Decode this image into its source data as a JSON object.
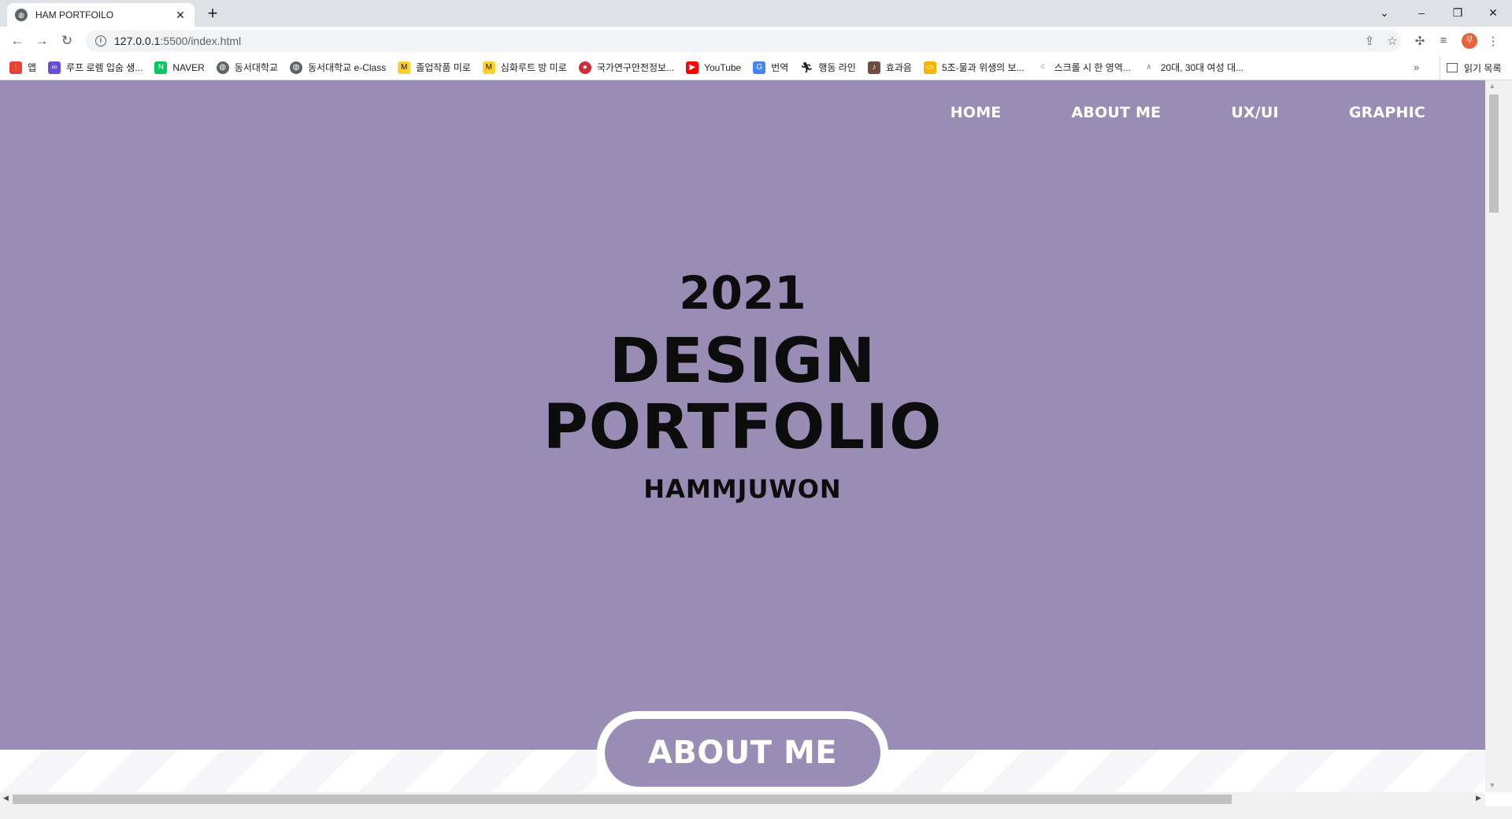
{
  "browser": {
    "tab_title": "HAM PORTFOILO",
    "url_host": "127.0.0.1",
    "url_path": ":5500/index.html",
    "bookmarks": [
      {
        "label": "앱",
        "icon": "apps-grid-icon",
        "color": "#e94235"
      },
      {
        "label": "루프 로렘 입숨 생...",
        "icon": "lorem-icon",
        "color": "#6c4bd6"
      },
      {
        "label": "NAVER",
        "icon": "naver-icon",
        "color": "#03c75a"
      },
      {
        "label": "동서대학교",
        "icon": "globe-icon",
        "color": "#5f6368"
      },
      {
        "label": "동서대학교 e-Class",
        "icon": "globe-icon",
        "color": "#5f6368"
      },
      {
        "label": "졸업작품 미로",
        "icon": "miro-icon",
        "color": "#ffd02f"
      },
      {
        "label": "심화루트 방 미로",
        "icon": "miro-icon",
        "color": "#ffd02f"
      },
      {
        "label": "국가연구안전정보...",
        "icon": "korea-flag-icon",
        "color": "#cd2e3a"
      },
      {
        "label": "YouTube",
        "icon": "youtube-icon",
        "color": "#ff0000"
      },
      {
        "label": "번역",
        "icon": "translate-icon",
        "color": "#4285f4"
      },
      {
        "label": "행동 라인",
        "icon": "runner-icon",
        "color": "#202124"
      },
      {
        "label": "효과음",
        "icon": "sound-icon",
        "color": "#6d4c41"
      },
      {
        "label": "5조-물과 위생의 보...",
        "icon": "slides-icon",
        "color": "#f4b400"
      },
      {
        "label": "스크롤 시 한 영역...",
        "icon": "dots-icon",
        "color": "#202124"
      },
      {
        "label": "20대, 30대 여성 대...",
        "icon": "link-icon",
        "color": "#7b6cd9"
      }
    ],
    "bookmarks_more": "»",
    "reading_list": "읽기 목록",
    "profile_initial": "무"
  },
  "site": {
    "nav": [
      "HOME",
      "ABOUT ME",
      "UX/UI",
      "GRAPHIC"
    ],
    "hero": {
      "year": "2021",
      "title_line1": "DESIGN",
      "title_line2": "PORTFOLIO",
      "name": "HAMMJUWON"
    },
    "section_button": "ABOUT ME",
    "colors": {
      "accent": "#998db6",
      "text": "#0c0c0c"
    }
  }
}
